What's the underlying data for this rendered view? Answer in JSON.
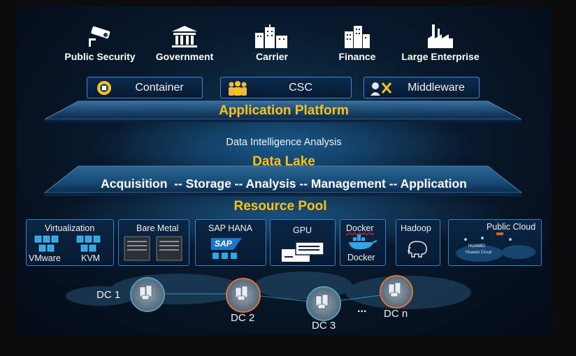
{
  "sectors": [
    {
      "label": "Public Security",
      "icon": "cctv-camera-icon"
    },
    {
      "label": "Government",
      "icon": "government-building-icon"
    },
    {
      "label": "Carrier",
      "icon": "city-tower-icon"
    },
    {
      "label": "Finance",
      "icon": "office-buildings-icon"
    },
    {
      "label": "Large Enterprise",
      "icon": "factory-icon"
    }
  ],
  "application_platform": {
    "title": "Application Platform",
    "chips": [
      {
        "label": "Container",
        "icon": "container-icon"
      },
      {
        "label": "CSC",
        "icon": "people-icon"
      },
      {
        "label": "Middleware",
        "icon": "middleware-tools-icon"
      }
    ]
  },
  "data_lake": {
    "subtitle": "Data Intelligence Analysis",
    "title": "Data Lake",
    "pipeline": "Acquisition  -- Storage -- Analysis -- Management -- Application"
  },
  "resource_pool": {
    "title": "Resource Pool",
    "virtualization": {
      "title": "Virtualization",
      "left": "VMware",
      "right": "KVM"
    },
    "bare_metal": {
      "title": "Bare Metal"
    },
    "sap_hana": {
      "title": "SAP HANA",
      "logo": "SAP"
    },
    "gpu": {
      "title": "GPU"
    },
    "docker": {
      "title": "Docker",
      "label": "Docker"
    },
    "hadoop": {
      "title": "Hadoop"
    },
    "public_cloud": {
      "title": "Public Cloud",
      "logo_text": "HUAWEI",
      "brand": "Huawei Cloud"
    }
  },
  "data_centers": [
    {
      "label": "DC 1"
    },
    {
      "label": "DC 2"
    },
    {
      "label": "DC 3"
    },
    {
      "label": "DC n"
    }
  ],
  "ellipsis": "...",
  "colors": {
    "accent_yellow": "#f7c21b",
    "frame_blue": "#3f8ad6",
    "dc_orange": "#d9763a",
    "dc_teal": "#4aa3b8"
  }
}
